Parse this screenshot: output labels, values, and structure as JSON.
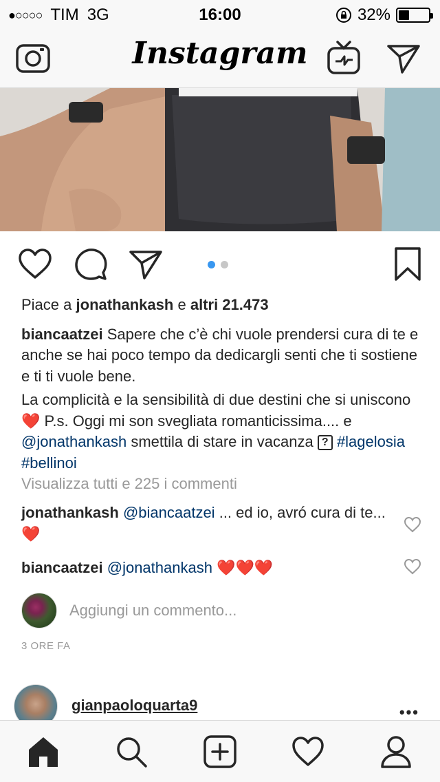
{
  "status_bar": {
    "signal": "●○○○○",
    "carrier": "TIM",
    "network": "3G",
    "time": "16:00",
    "battery_percent": "32%",
    "battery_level": 0.32
  },
  "header": {
    "logo_text": "Instagram",
    "icons": [
      "camera-icon",
      "igtv-icon",
      "direct-message-icon"
    ]
  },
  "carousel": {
    "page_count": 2,
    "active_index": 0
  },
  "actions": {
    "icons": [
      "like-heart-icon",
      "comment-bubble-icon",
      "share-paper-plane-icon",
      "bookmark-icon"
    ]
  },
  "post": {
    "likes_prefix": "Piace a",
    "likes_user": "jonathankash",
    "likes_join": "e",
    "likes_others": "altri 21.473",
    "caption_user": "biancaatzei",
    "caption_line1": "Sapere che c’è chi vuole prendersi cura di te e anche se hai poco tempo da dedicargli senti che ti sostiene e ti ti vuole bene.",
    "caption_line2_a": "La complicità e la sensibilità di due destini che si uniscono",
    "caption_heart": "❤️",
    "caption_line2_b": "P.s. Oggi mi son svegliata romanticissima.... e",
    "caption_mention": "@jonathankash",
    "caption_line2_c": "smettila di stare in vacanza",
    "caption_box": "?",
    "hashtag1": "#lagelosia",
    "hashtag2": "#bellinoi",
    "view_all_comments": "Visualizza tutti e 225 i commenti",
    "timestamp": "3 ORE FA"
  },
  "comments": [
    {
      "user": "jonathankash",
      "mention": "@biancaatzei",
      "text": "... ed io, avró cura di te...",
      "emoji": "❤️"
    },
    {
      "user": "biancaatzei",
      "mention": "@jonathankash",
      "text": "",
      "emoji": "❤️❤️❤️"
    }
  ],
  "add_comment": {
    "placeholder": "Aggiungi un commento..."
  },
  "next_post": {
    "username": "gianpaoloquarta9",
    "more": "•••"
  },
  "bottom_nav": {
    "icons": [
      "home-icon",
      "search-icon",
      "new-post-icon",
      "activity-heart-icon",
      "profile-icon"
    ]
  },
  "colors": {
    "link": "#003569",
    "muted": "#999999",
    "accent": "#3897f0",
    "heart": "#e0181e"
  }
}
